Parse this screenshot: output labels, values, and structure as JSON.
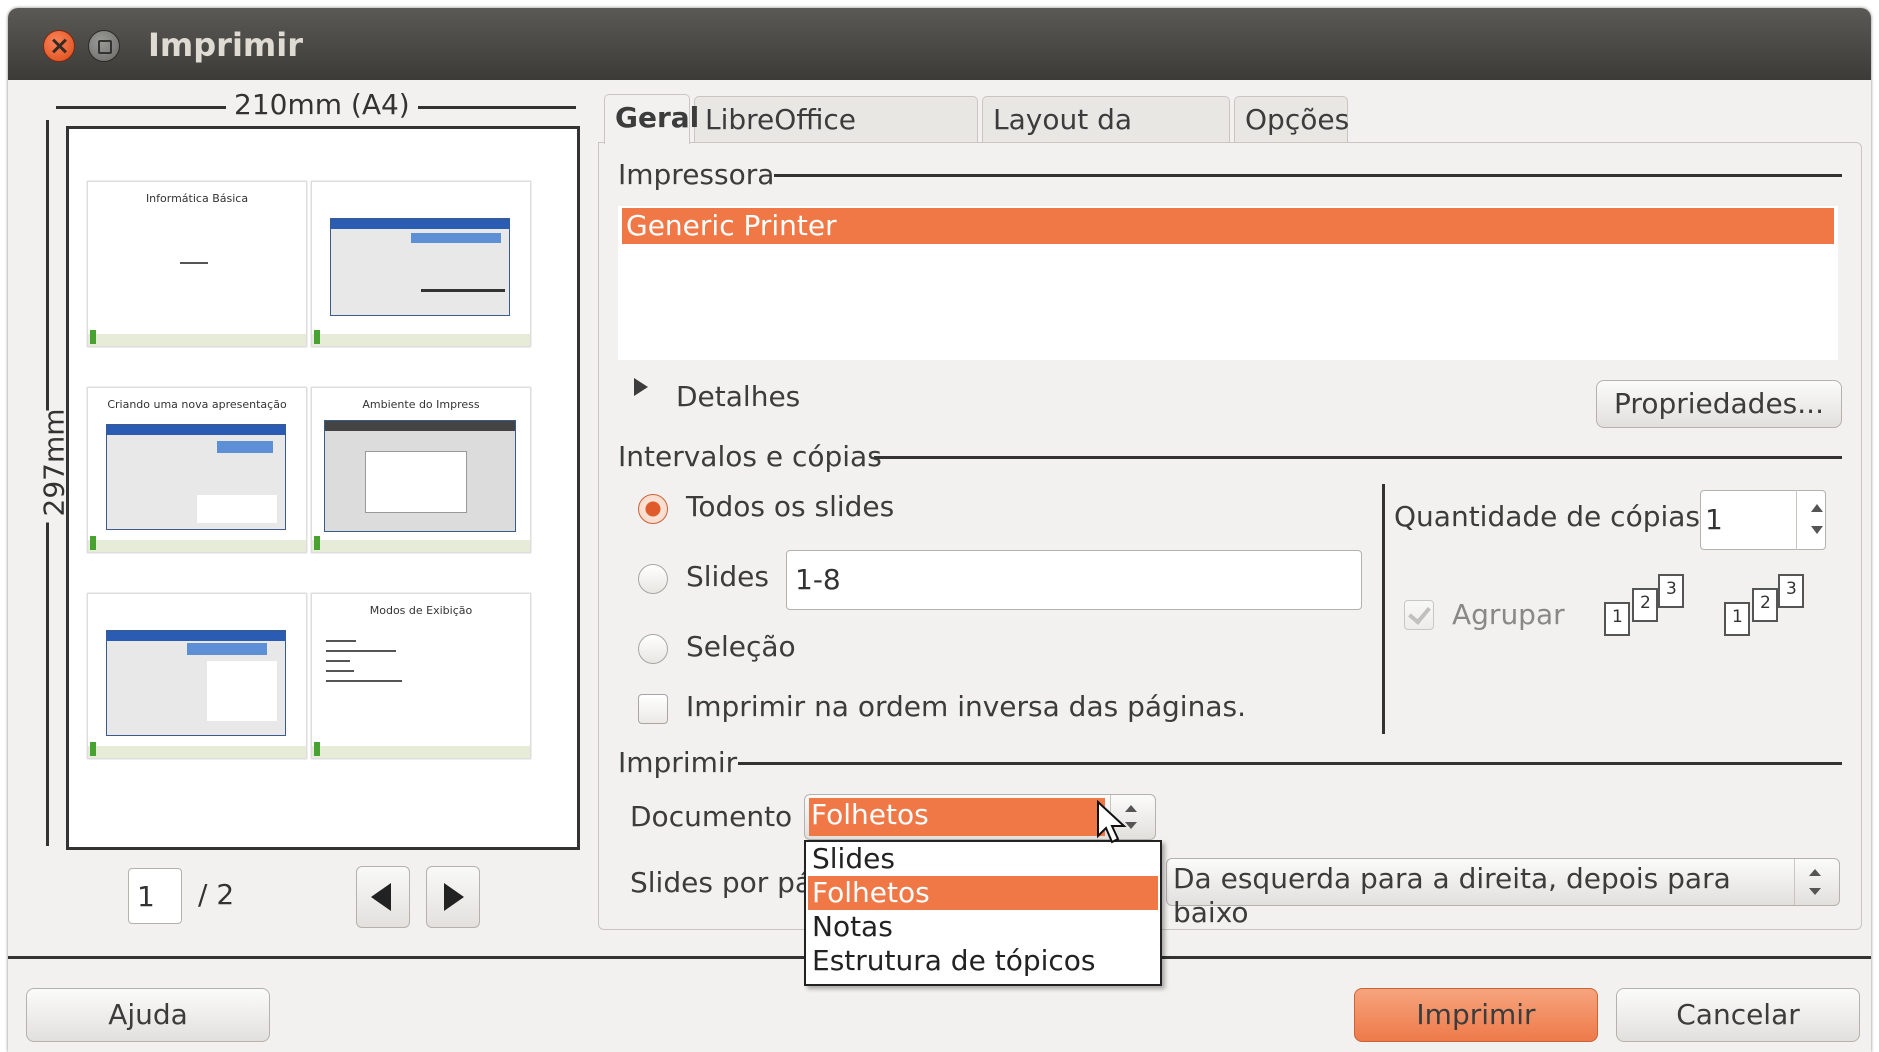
{
  "window": {
    "title": "Imprimir"
  },
  "preview": {
    "width_label": "210mm (A4)",
    "height_label": "297mm",
    "thumbnails": [
      {
        "title": "Informática Básica"
      },
      {
        "title": ""
      },
      {
        "title": "Criando uma nova apresentação"
      },
      {
        "title": "Ambiente do Impress"
      },
      {
        "title": ""
      },
      {
        "title": "Modos de Exibição"
      }
    ],
    "current_page": "1",
    "total_pages": "/ 2"
  },
  "tabs": [
    {
      "label": "Geral"
    },
    {
      "label": "LibreOffice Impress"
    },
    {
      "label": "Layout da página"
    },
    {
      "label": "Opções"
    }
  ],
  "printer": {
    "section": "Impressora",
    "selected": "Generic Printer",
    "details": "Detalhes",
    "properties": "Propriedades..."
  },
  "ranges": {
    "section": "Intervalos e cópias",
    "all_slides": "Todos os slides",
    "slides": "Slides",
    "slides_value": "1-8",
    "selection": "Seleção",
    "reverse": "Imprimir na ordem inversa das páginas.",
    "copies_label": "Quantidade de cópias",
    "copies_value": "1",
    "collate": "Agrupar"
  },
  "print": {
    "section": "Imprimir",
    "document_label": "Documento",
    "document_value": "Folhetos",
    "slides_per_page_label": "Slides por pá",
    "order_value": "Da esquerda para a direita, depois para baixo",
    "options": [
      "Slides",
      "Folhetos",
      "Notas",
      "Estrutura de tópicos"
    ]
  },
  "buttons": {
    "help": "Ajuda",
    "print": "Imprimir",
    "cancel": "Cancelar"
  },
  "colors": {
    "accent": "#f07746",
    "titlebar": "#3c3b37"
  }
}
